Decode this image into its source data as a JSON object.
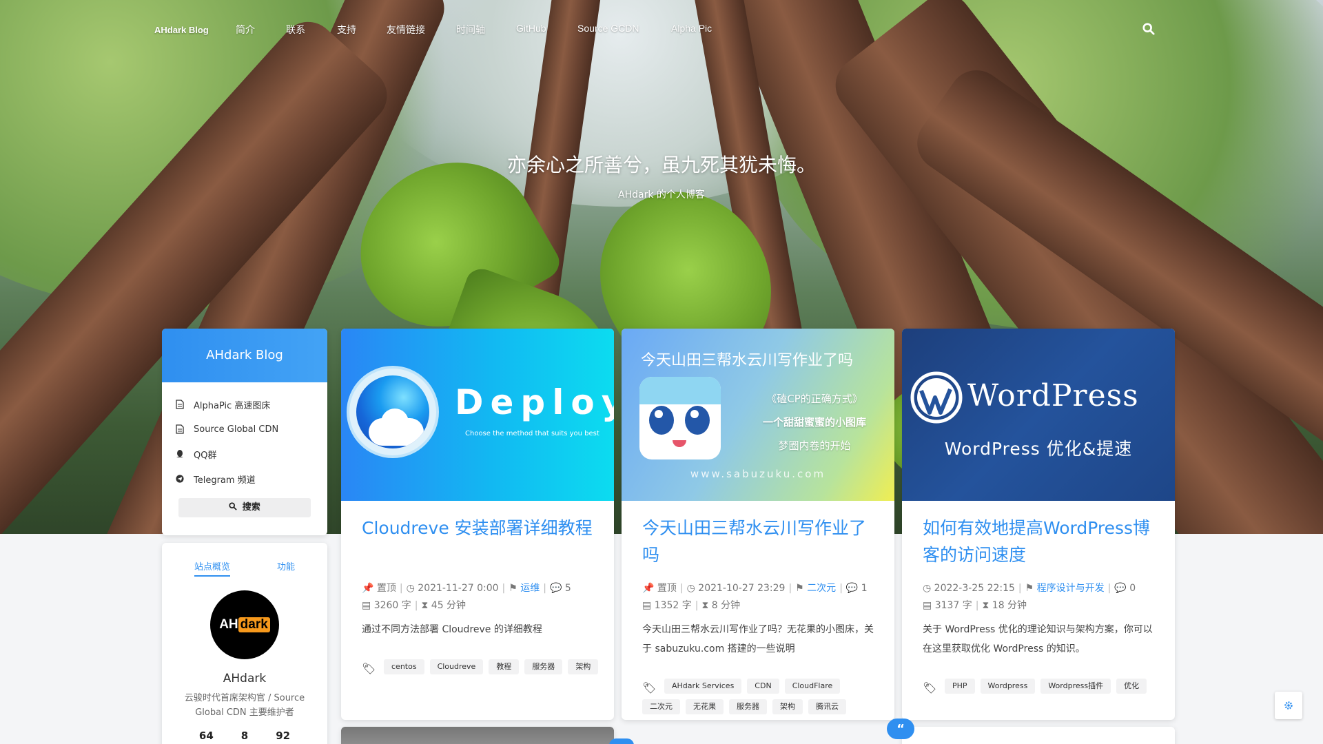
{
  "nav": {
    "brand": "AHdark Blog",
    "items": [
      "简介",
      "联系",
      "支持",
      "友情链接",
      "时间轴",
      "GitHub",
      "Source GCDN",
      "Alpha Pic"
    ]
  },
  "hero": {
    "title": "亦余心之所善兮，虽九死其犹未悔。",
    "subtitle": "AHdark 的个人博客"
  },
  "sidebar": {
    "title": "AHdark Blog",
    "links": [
      {
        "label": "AlphaPic 高速图床",
        "icon": "file-icon"
      },
      {
        "label": "Source Global CDN",
        "icon": "file-icon"
      },
      {
        "label": "QQ群",
        "icon": "qq-icon"
      },
      {
        "label": "Telegram 频道",
        "icon": "telegram-icon"
      }
    ],
    "search_label": "搜索"
  },
  "profile": {
    "tabs": [
      "站点概览",
      "功能"
    ],
    "avatar_ah": "AH",
    "avatar_dark": "dark",
    "name": "AHdark",
    "bio": "云骏时代首席架构官 / Source Global CDN 主要维护者",
    "stats": [
      "64",
      "8",
      "92"
    ]
  },
  "posts": [
    {
      "cover_title": "Deploy",
      "cover_sub": "Choose the method that suits you best",
      "title": "Cloudreve 安装部署详细教程",
      "pinned": "置顶",
      "date": "2021-11-27 0:00",
      "category": "运维",
      "comments": "5",
      "words": "3260 字",
      "read_time": "45 分钟",
      "excerpt": "通过不同方法部署 Cloudreve 的详细教程",
      "tags": [
        "centos",
        "Cloudreve",
        "教程",
        "服务器",
        "架构"
      ]
    },
    {
      "cover_title": "今天山田三帮水云川写作业了吗",
      "cover_lines": [
        "《磕CP的正确方式》",
        "一个甜甜蜜蜜的小图库",
        "梦圈内卷的开始"
      ],
      "cover_url": "www.sabuzuku.com",
      "title": "今天山田三帮水云川写作业了吗",
      "pinned": "置顶",
      "date": "2021-10-27 23:29",
      "category": "二次元",
      "comments": "1",
      "words": "1352 字",
      "read_time": "8 分钟",
      "excerpt": "今天山田三帮水云川写作业了吗？无花果的小图床，关于 sabuzuku.com 搭建的一些说明",
      "tags": [
        "AHdark Services",
        "CDN",
        "CloudFlare",
        "二次元",
        "无花果",
        "服务器",
        "架构",
        "腾讯云"
      ]
    },
    {
      "cover_title": "WordPress",
      "cover_sub": "WordPress 优化&提速",
      "title": "如何有效地提高WordPress博客的访问速度",
      "date": "2022-3-25 22:15",
      "category": "程序设计与开发",
      "comments": "0",
      "words": "3137 字",
      "read_time": "18 分钟",
      "excerpt": "关于 WordPress 优化的理论知识与架构方案，你可以在这里获取优化 WordPress 的知识。",
      "tags": [
        "PHP",
        "Wordpress",
        "Wordpress插件",
        "优化"
      ]
    }
  ],
  "colors": {
    "accent": "#2f8ff0",
    "wp_blue": "#1f4a8c",
    "avatar_orange": "#f7991c"
  }
}
